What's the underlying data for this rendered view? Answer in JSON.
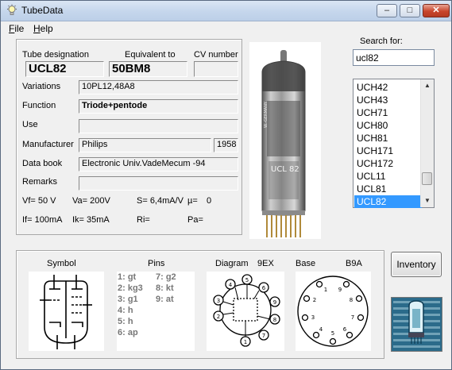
{
  "window": {
    "title": "TubeData"
  },
  "menu": {
    "file": "File",
    "help": "Help"
  },
  "labels": {
    "tube_designation": "Tube designation",
    "equivalent_to": "Equivalent to",
    "cv_number": "CV number",
    "variations": "Variations",
    "function": "Function",
    "use": "Use",
    "manufacturer": "Manufacturer",
    "data_book": "Data book",
    "remarks": "Remarks",
    "search_for": "Search for:",
    "symbol": "Symbol",
    "pins": "Pins",
    "diagram": "Diagram",
    "base": "Base"
  },
  "tube": {
    "designation": "UCL82",
    "equivalent": "50BM8",
    "cv_number": "",
    "variations": "10PL12,48A8",
    "function": "Triode+pentode",
    "use": "",
    "manufacturer": "Philips",
    "year": "1958",
    "data_book": "Electronic Univ.VadeMecum -94",
    "remarks": "",
    "diagram_code": "9EX",
    "base_code": "B9A"
  },
  "params": {
    "vf": "Vf= 50 V",
    "va": "Va= 200V",
    "s": "S= 6,4mA/V",
    "mu": "µ=",
    "mu_val": "0",
    "if": "If= 100mA",
    "ik": "Ik= 35mA",
    "ri": "Ri=",
    "pa": "Pa="
  },
  "search": {
    "value": "ucl82"
  },
  "list": {
    "items": [
      "UCH42",
      "UCH43",
      "UCH71",
      "UCH80",
      "UCH81",
      "UCH171",
      "UCH172",
      "UCL11",
      "UCL81",
      "UCL82"
    ],
    "selected": "UCL82"
  },
  "pins": {
    "col1": [
      "1: gt",
      "2: kg3",
      "3: g1",
      "4: h",
      "5: h",
      "6: ap"
    ],
    "col2": [
      "7: g2",
      "8: kt",
      "9: at"
    ]
  },
  "tube_image": {
    "label": "UCL 82",
    "country": "W.-GERMANY"
  },
  "buttons": {
    "inventory": "Inventory",
    "minimize": "–",
    "maximize": "□",
    "close": "✕"
  },
  "icons": [
    "lightbulb-icon",
    "minimize-icon",
    "maximize-icon",
    "close-icon",
    "scroll-up-icon",
    "scroll-down-icon",
    "tube-logo-icon"
  ]
}
